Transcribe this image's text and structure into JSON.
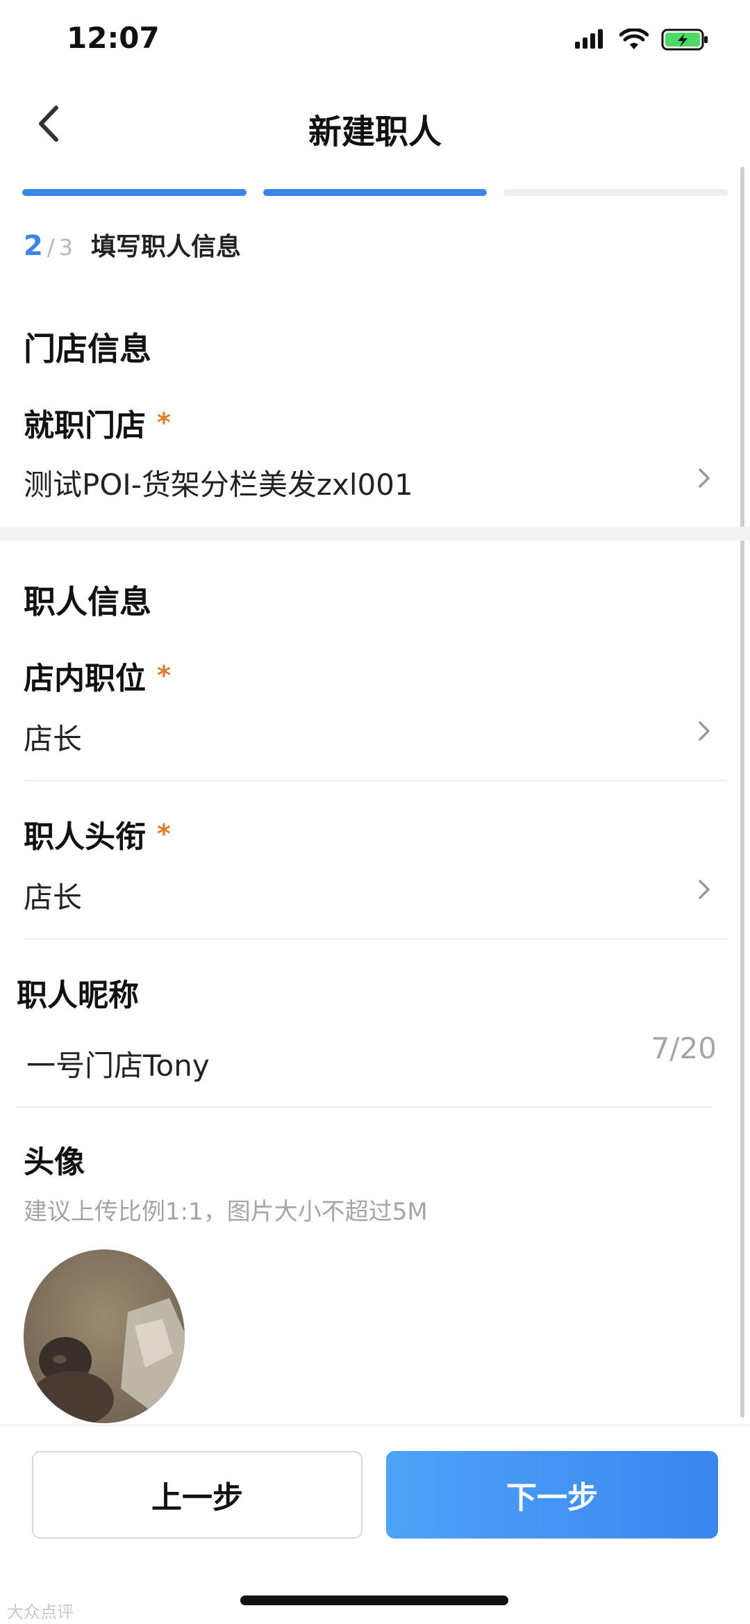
{
  "status": {
    "time": "12:07"
  },
  "nav": {
    "title": "新建职人"
  },
  "progress": {
    "current": "2",
    "separator": "/",
    "total": "3",
    "label": "填写职人信息",
    "segments_active": 2,
    "segments_total": 3
  },
  "store_section": {
    "title": "门店信息",
    "store_label": "就职门店",
    "required_mark": "*",
    "store_value": "测试POI-货架分栏美发zxl001"
  },
  "staff_section": {
    "title": "职人信息",
    "position_label": "店内职位",
    "position_value": "店长",
    "title_label": "职人头衔",
    "title_value": "店长",
    "nickname_label": "职人昵称",
    "nickname_value": "一号门店Tony",
    "nickname_counter": "7/20",
    "avatar_label": "头像",
    "avatar_hint": "建议上传比例1:1，图片大小不超过5M"
  },
  "buttons": {
    "prev": "上一步",
    "next": "下一步"
  },
  "watermark": "大众点评",
  "colors": {
    "accent": "#3a86e8",
    "required": "#e07b2c"
  }
}
